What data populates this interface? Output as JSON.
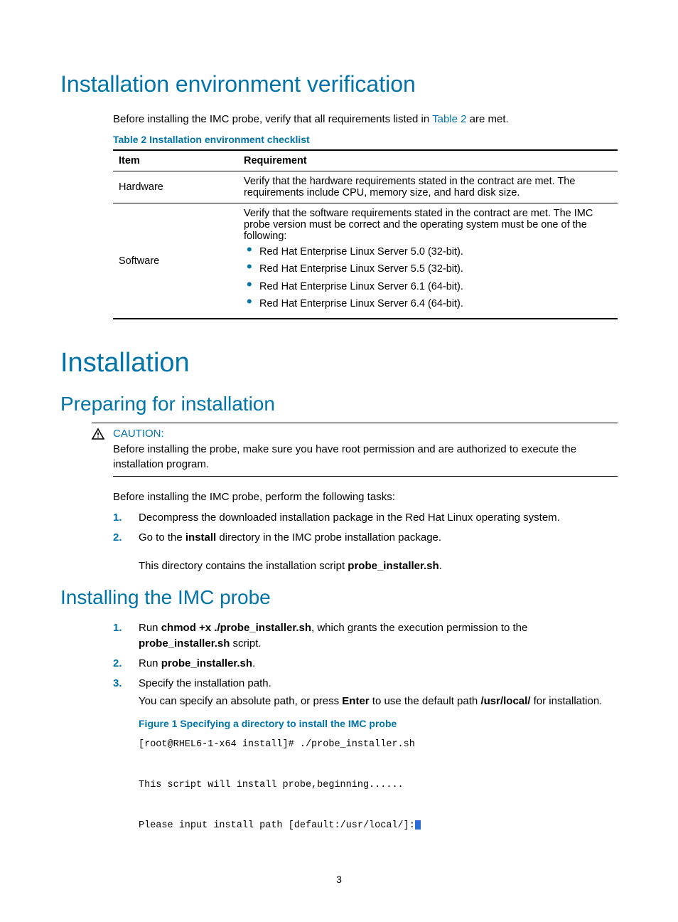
{
  "section1": {
    "title": "Installation environment verification",
    "intro_before_link": "Before installing the IMC probe, verify that all requirements listed in ",
    "intro_link": "Table 2",
    "intro_after_link": " are met.",
    "table_title": "Table 2 Installation environment checklist",
    "table": {
      "headers": [
        "Item",
        "Requirement"
      ],
      "row1": {
        "item": "Hardware",
        "req": "Verify that the hardware requirements stated in the contract are met. The requirements include CPU, memory size, and hard disk size."
      },
      "row2": {
        "item": "Software",
        "intro": "Verify that the software requirements stated in the contract are met. The IMC probe version must be correct and the operating system must be one of the following:",
        "bullets": [
          "Red Hat Enterprise Linux Server 5.0 (32-bit).",
          "Red Hat Enterprise Linux Server 5.5 (32-bit).",
          "Red Hat Enterprise Linux Server 6.1 (64-bit).",
          "Red Hat Enterprise Linux Server 6.4 (64-bit)."
        ]
      }
    }
  },
  "section2": {
    "title": "Installation",
    "sub1": {
      "title": "Preparing for installation",
      "caution_label": "CAUTION:",
      "caution_text": "Before installing the probe, make sure you have root permission and are authorized to execute the installation program.",
      "lead": "Before installing the IMC probe, perform the following tasks:",
      "steps": [
        "Decompress the downloaded installation package in the Red Hat Linux operating system."
      ],
      "step2_prefix": "Go to the ",
      "step2_bold": "install",
      "step2_suffix": " directory in the IMC probe installation package.",
      "step2_sub_prefix": "This directory contains the installation script ",
      "step2_sub_bold": "probe_installer.sh",
      "step2_sub_suffix": "."
    },
    "sub2": {
      "title": "Installing the IMC probe",
      "step1_prefix": "Run ",
      "step1_bold": "chmod +x ./probe_installer.sh",
      "step1_mid": ", which grants the execution permission to the ",
      "step1_bold2": "probe_installer.sh",
      "step1_suffix": " script.",
      "step2_prefix": "Run ",
      "step2_bold": "probe_installer.sh",
      "step2_suffix": ".",
      "step3": "Specify the installation path.",
      "step3_sub_prefix": "You can specify an absolute path, or press ",
      "step3_sub_bold": "Enter",
      "step3_sub_mid": " to use the default path ",
      "step3_sub_bold2": "/usr/local/",
      "step3_sub_suffix": " for installation.",
      "figure_title": "Figure 1 Specifying a directory to install the IMC probe",
      "terminal": {
        "line1": "[root@RHEL6-1-x64 install]# ./probe_installer.sh",
        "line2": "This script will install probe,beginning......",
        "line3": "Please input install path [default:/usr/local/]:"
      }
    }
  },
  "page_number": "3"
}
